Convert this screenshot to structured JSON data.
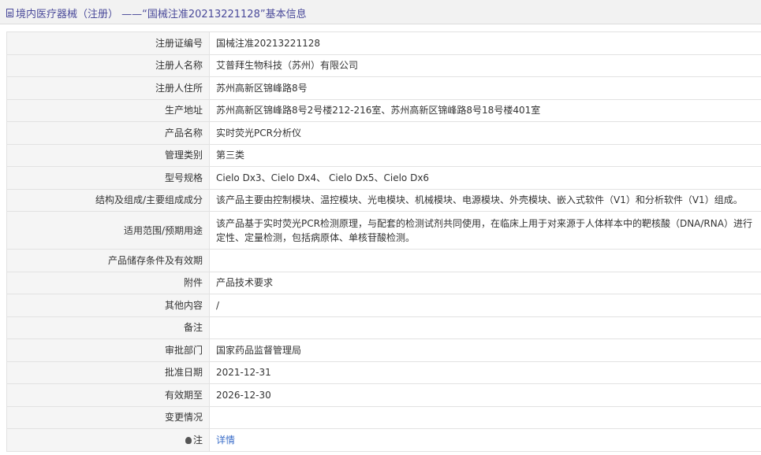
{
  "header": {
    "title": "境内医疗器械（注册） ——“国械注准20213221128”基本信息"
  },
  "rows": [
    {
      "label": "注册证编号",
      "value": "国械注准20213221128"
    },
    {
      "label": "注册人名称",
      "value": "艾普拜生物科技（苏州）有限公司"
    },
    {
      "label": "注册人住所",
      "value": "苏州高新区锦峰路8号"
    },
    {
      "label": "生产地址",
      "value": "苏州高新区锦峰路8号2号楼212-216室、苏州高新区锦峰路8号18号楼401室"
    },
    {
      "label": "产品名称",
      "value": "实时荧光PCR分析仪"
    },
    {
      "label": "管理类别",
      "value": "第三类"
    },
    {
      "label": "型号规格",
      "value": "Cielo Dx3、Cielo Dx4、 Cielo Dx5、Cielo Dx6"
    },
    {
      "label": "结构及组成/主要组成成分",
      "value": "该产品主要由控制模块、温控模块、光电模块、机械模块、电源模块、外壳模块、嵌入式软件（V1）和分析软件（V1）组成。"
    },
    {
      "label": "适用范围/预期用途",
      "value": "该产品基于实时荧光PCR检测原理，与配套的检测试剂共同使用，在临床上用于对来源于人体样本中的靶核酸（DNA/RNA）进行定性、定量检测，包括病原体、单核苷酸检测。"
    },
    {
      "label": "产品储存条件及有效期",
      "value": ""
    },
    {
      "label": "附件",
      "value": "产品技术要求"
    },
    {
      "label": "其他内容",
      "value": "/"
    },
    {
      "label": "备注",
      "value": ""
    },
    {
      "label": "审批部门",
      "value": "国家药品监督管理局"
    },
    {
      "label": "批准日期",
      "value": "2021-12-31"
    },
    {
      "label": "有效期至",
      "value": "2026-12-30"
    },
    {
      "label": "变更情况",
      "value": ""
    }
  ],
  "note": {
    "label": "注",
    "icon": "bulb-icon",
    "link_text": "详情"
  },
  "colors": {
    "title": "#4a4a9a",
    "link": "#3b6ec9",
    "label_bg": "#f5f5f5",
    "border": "#e2e2e2"
  }
}
